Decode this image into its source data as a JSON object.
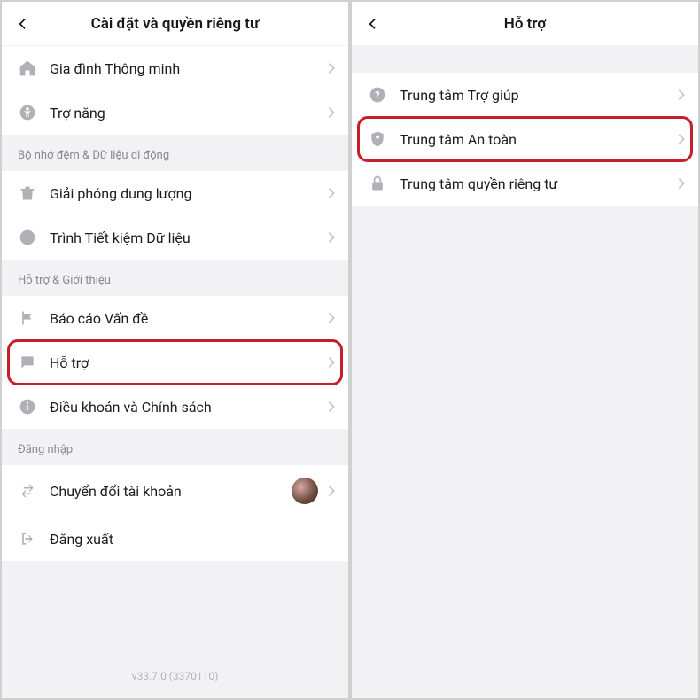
{
  "left": {
    "title": "Cài đặt và quyền riêng tư",
    "group1": [
      {
        "label": "Gia đình Thông minh"
      },
      {
        "label": "Trợ năng"
      }
    ],
    "section2_header": "Bộ nhớ đệm & Dữ liệu di động",
    "group2": [
      {
        "label": "Giải phóng dung lượng"
      },
      {
        "label": "Trình Tiết kiệm Dữ liệu"
      }
    ],
    "section3_header": "Hỗ trợ & Giới thiệu",
    "group3": [
      {
        "label": "Báo cáo Vấn đề"
      },
      {
        "label": "Hỗ trợ"
      },
      {
        "label": "Điều khoản và Chính sách"
      }
    ],
    "section4_header": "Đăng nhập",
    "group4": [
      {
        "label": "Chuyển đổi tài khoản"
      },
      {
        "label": "Đăng xuất"
      }
    ],
    "version": "v33.7.0 (3370110)"
  },
  "right": {
    "title": "Hỗ trợ",
    "items": [
      {
        "label": "Trung tâm Trợ giúp"
      },
      {
        "label": "Trung tâm An toàn"
      },
      {
        "label": "Trung tâm quyền riêng tư"
      }
    ]
  }
}
